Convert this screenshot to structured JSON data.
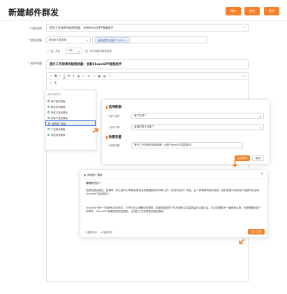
{
  "page": {
    "title": "新建邮件群发"
  },
  "topbar": {
    "btn1": "保存",
    "btn2": "预览",
    "btn3": "发送"
  },
  "form": {
    "labels": {
      "name": "* 内容名称",
      "recipients": "* 群发对象",
      "schedule": "定时发送",
      "subject": "* 邮件标题"
    },
    "name_value": "提升工作效率的秘密武器：全新ShareGPT智能助手",
    "recipient_select": "按目标人群选择",
    "recipient_tag": "营销成果不佳客户(5000) ×",
    "toggle_text": "关闭",
    "time_value": "1天",
    "schedule_hint": "为打造高效群发程序",
    "subject_value": "提升工作效率的秘密武器：全新ShareGPT智能助手"
  },
  "dropdown": {
    "header": "推荐可用内容",
    "items": [
      "客户回访模板",
      "新品发布模板",
      "老客户激活模板",
      "老客户激活模板",
      "商品推广模板",
      "广告宣传模板",
      "商品宣传模板"
    ]
  },
  "config_panel": {
    "section1": "选择数据",
    "field1_label": "* 客户名称",
    "field1_value": "客户名称广",
    "field2_label": "* 目标人群",
    "field2_value": "营销成果不佳客户",
    "section2": "场景变量",
    "field3_label": "* 邮件标题",
    "field3_value": "提升工作效率的秘密武器：全新ShareGPT智能助手",
    "generate_btn": "生成邮件",
    "cancel_btn": "取消"
  },
  "email_panel": {
    "title": "商品推广模板",
    "greeting": "尊敬的用户：",
    "para1": "您是否曾经想过，如果有一种工具可以帮助您更有效地管理您的时间和工作，那该有多好？现在，这个梦想即将成为现实！我们很高兴地向您介绍我们的全新ShareGPT智能助手。",
    "para2": "ShareGPT是一个革命性的AI助手，它不仅可以理解您的需求，更能根据您的个性化需求生成高质量的文案内容。无论您需要写一篇营销文案，还是需要回复一封邮件，ShareGPT都能帮您轻松搞定，让您的工作变得更加轻松高效。",
    "copy_link": "重新生成",
    "insert_link": "复制文本",
    "use_btn": "插入文档"
  },
  "colors": {
    "accent": "#f5822a",
    "tag_blue": "#3b64b4"
  }
}
